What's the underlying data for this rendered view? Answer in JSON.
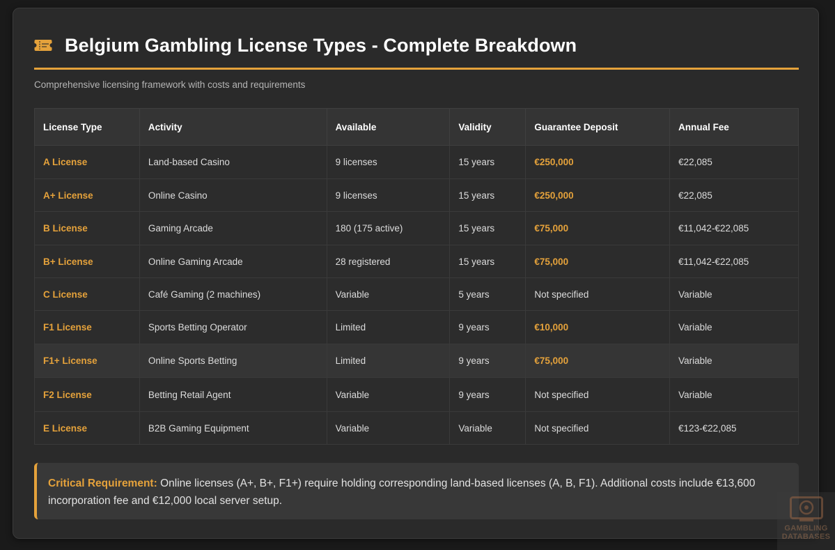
{
  "header": {
    "icon": "ticket-icon",
    "title": "Belgium Gambling License Types - Complete Breakdown",
    "subtitle": "Comprehensive licensing framework with costs and requirements"
  },
  "table": {
    "columns": [
      "License Type",
      "Activity",
      "Available",
      "Validity",
      "Guarantee Deposit",
      "Annual Fee"
    ],
    "rows": [
      {
        "type": "A License",
        "activity": "Land-based Casino",
        "available": "9 licenses",
        "validity": "15 years",
        "deposit": "€250,000",
        "fee": "€22,085"
      },
      {
        "type": "A+ License",
        "activity": "Online Casino",
        "available": "9 licenses",
        "validity": "15 years",
        "deposit": "€250,000",
        "fee": "€22,085"
      },
      {
        "type": "B License",
        "activity": "Gaming Arcade",
        "available": "180 (175 active)",
        "validity": "15 years",
        "deposit": "€75,000",
        "fee": "€11,042-€22,085"
      },
      {
        "type": "B+ License",
        "activity": "Online Gaming Arcade",
        "available": "28 registered",
        "validity": "15 years",
        "deposit": "€75,000",
        "fee": "€11,042-€22,085"
      },
      {
        "type": "C License",
        "activity": "Café Gaming (2 machines)",
        "available": "Variable",
        "validity": "5 years",
        "deposit": "Not specified",
        "fee": "Variable"
      },
      {
        "type": "F1 License",
        "activity": "Sports Betting Operator",
        "available": "Limited",
        "validity": "9 years",
        "deposit": "€10,000",
        "fee": "Variable"
      },
      {
        "type": "F1+ License",
        "activity": "Online Sports Betting",
        "available": "Limited",
        "validity": "9 years",
        "deposit": "€75,000",
        "fee": "Variable"
      },
      {
        "type": "F2 License",
        "activity": "Betting Retail Agent",
        "available": "Variable",
        "validity": "9 years",
        "deposit": "Not specified",
        "fee": "Variable"
      },
      {
        "type": "E License",
        "activity": "B2B Gaming Equipment",
        "available": "Variable",
        "validity": "Variable",
        "deposit": "Not specified",
        "fee": "€123-€22,085"
      }
    ]
  },
  "note": {
    "label": "Critical Requirement:",
    "text": " Online licenses (A+, B+, F1+) require holding corresponding land-based licenses (A, B, F1). Additional costs include €13,600 incorporation fee and €12,000 local server setup."
  },
  "watermark": {
    "icon": "gambling-databases-logo",
    "line1": "GAMBLING",
    "line2": "DATABASES"
  },
  "colors": {
    "accent": "#e5a23b",
    "background": "#1a1a1a",
    "card": "#2a2a2a"
  }
}
